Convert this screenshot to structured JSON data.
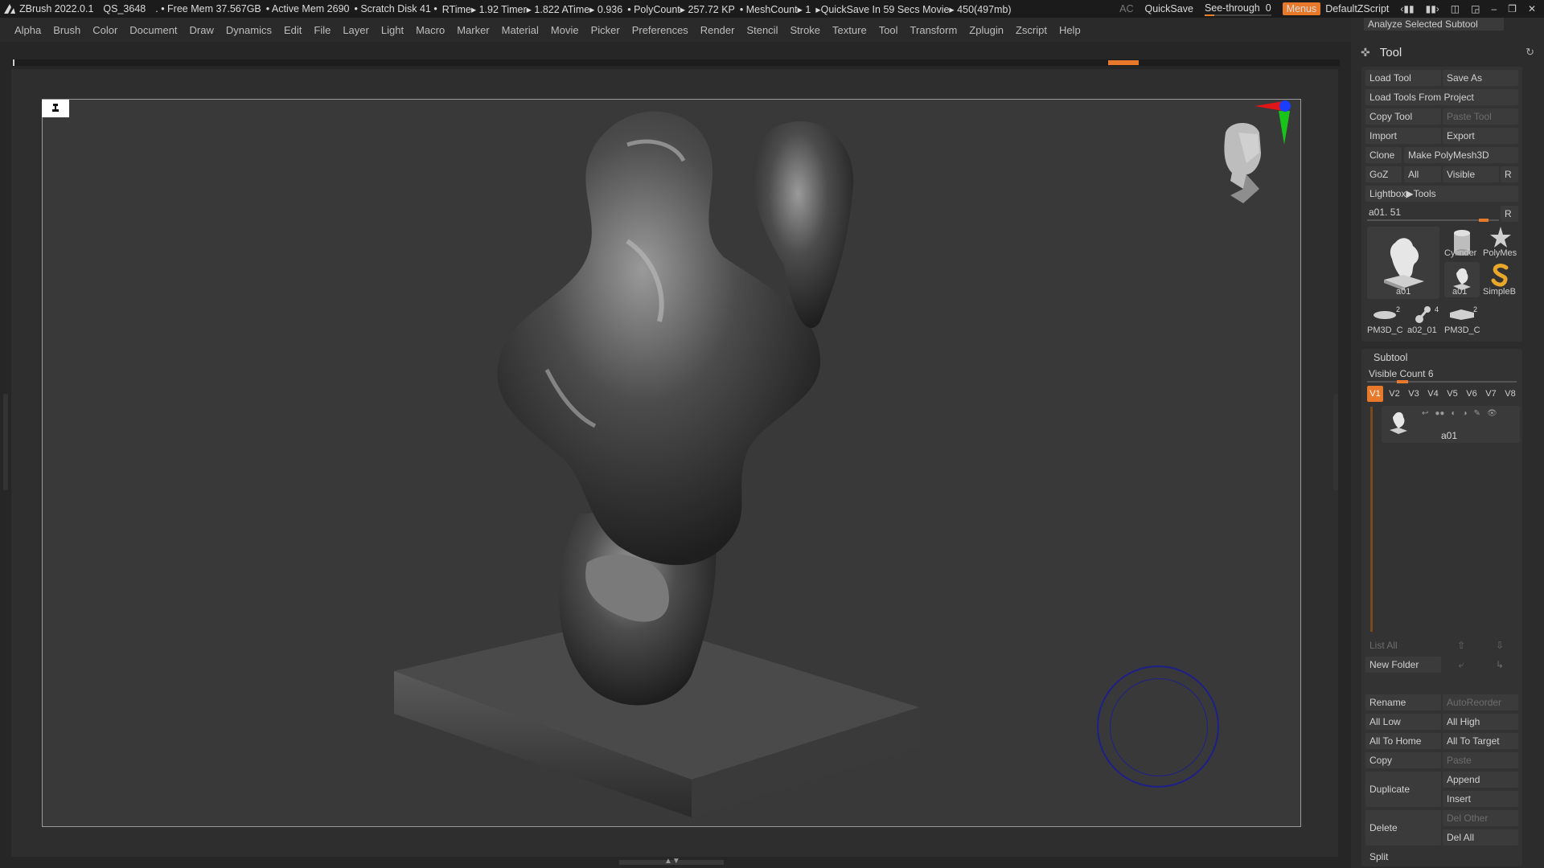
{
  "titlebar": {
    "app": "ZBrush 2022.0.1",
    "doc": "QS_3648",
    "free_mem": ". • Free Mem 37.567GB",
    "active_mem": "• Active Mem 2690",
    "scratch": "• Scratch Disk 41 •",
    "rtime": "RTime▸ 1.92 Timer▸ 1.822 ATime▸ 0.936",
    "polycount": "• PolyCount▸ 257.72 KP",
    "meshcount": "• MeshCount▸ 1",
    "quicksave_info": "▸QuickSave In 59 Secs Movie▸ 450(497mb)",
    "ac": "AC",
    "quicksave": "QuickSave",
    "see_through": "See-through",
    "see_through_value": "0",
    "menus": "Menus",
    "default_zscript": "DefaultZScript"
  },
  "menubar": [
    "Alpha",
    "Brush",
    "Color",
    "Document",
    "Draw",
    "Dynamics",
    "Edit",
    "File",
    "Layer",
    "Light",
    "Macro",
    "Marker",
    "Material",
    "Movie",
    "Picker",
    "Preferences",
    "Render",
    "Stencil",
    "Stroke",
    "Texture",
    "Tool",
    "Transform",
    "Zplugin",
    "Zscript",
    "Help"
  ],
  "panel": {
    "analyze": "Analyze Selected Subtool",
    "title": "Tool",
    "load_tool": "Load Tool",
    "save_as": "Save As",
    "load_from_project": "Load Tools From Project",
    "copy_tool": "Copy Tool",
    "paste_tool": "Paste Tool",
    "import": "Import",
    "export": "Export",
    "clone": "Clone",
    "make_polymesh": "Make PolyMesh3D",
    "goz": "GoZ",
    "all": "All",
    "visible": "Visible",
    "r": "R",
    "lightbox_tools": "Lightbox▶Tools",
    "tool_slider_label": "a01. 51",
    "tool_slider_value": 0.92,
    "thumbs": {
      "main": "a01",
      "cylinder": "Cylinder",
      "polymesh": "PolyMes",
      "a01_small": "a01",
      "simpleb": "SimpleB",
      "pm3d_1": "PM3D_C",
      "pm3d_1_num": "2",
      "a02": "a02_01",
      "a02_num": "4",
      "pm3d_2": "PM3D_C",
      "pm3d_2_num": "2"
    },
    "subtool": {
      "header": "Subtool",
      "visible_count": "Visible Count 6",
      "visible_count_fraction": 0.2,
      "tabs": [
        "V1",
        "V2",
        "V3",
        "V4",
        "V5",
        "V6",
        "V7",
        "V8"
      ],
      "item_name": "a01",
      "list_all": "List All",
      "new_folder": "New Folder",
      "rename": "Rename",
      "autoreorder": "AutoReorder",
      "all_low": "All Low",
      "all_high": "All High",
      "all_to_home": "All To Home",
      "all_to_target": "All To Target",
      "copy": "Copy",
      "paste": "Paste",
      "duplicate": "Duplicate",
      "append": "Append",
      "insert": "Insert",
      "delete": "Delete",
      "del_other": "Del Other",
      "del_all": "Del All",
      "split": "Split"
    }
  },
  "colors": {
    "accent": "#e8792b",
    "background": "#262626",
    "canvas": "#393939",
    "panel": "#2c2c2c",
    "button": "#3b3b3b"
  }
}
